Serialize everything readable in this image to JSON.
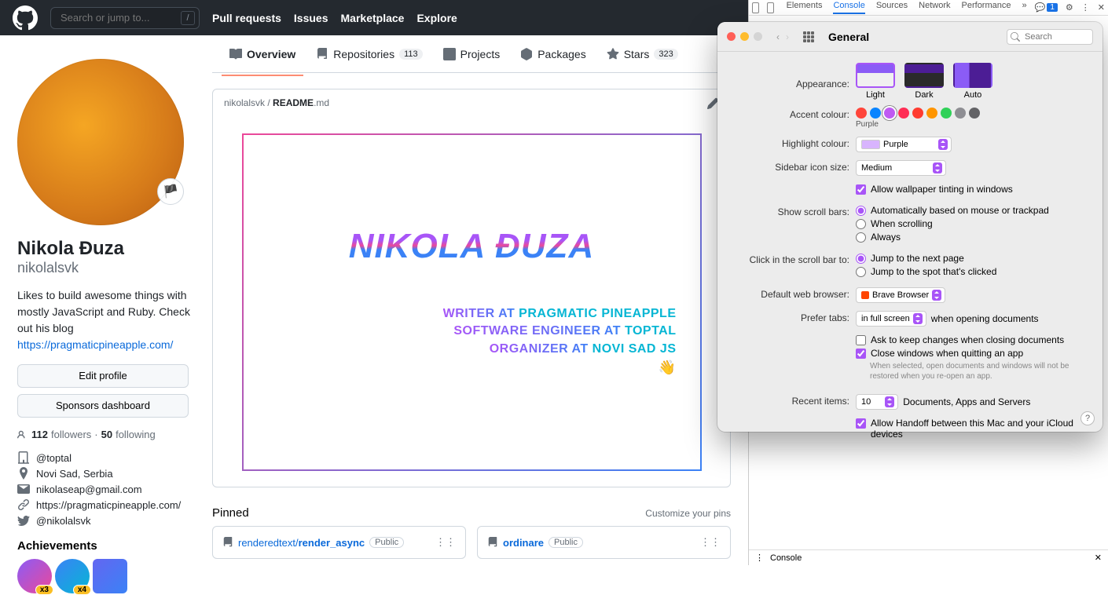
{
  "github": {
    "search_placeholder": "Search or jump to...",
    "slash": "/",
    "nav": {
      "pull": "Pull requests",
      "issues": "Issues",
      "marketplace": "Marketplace",
      "explore": "Explore"
    },
    "plus_caret": "+"
  },
  "profile": {
    "full_name": "Nikola Đuza",
    "username": "nikolalsvk",
    "bio_1": "Likes to build awesome things with mostly JavaScript and Ruby. Check out his blog ",
    "bio_link": "https://pragmaticpineapple.com/",
    "edit_btn": "Edit profile",
    "sponsors_btn": "Sponsors dashboard",
    "followers_n": "112",
    "followers_l": "followers",
    "following_n": "50",
    "following_l": "following",
    "org": "@toptal",
    "location": "Novi Sad, Serbia",
    "email": "nikolaseap@gmail.com",
    "website": "https://pragmaticpineapple.com/",
    "twitter": "@nikolalsvk",
    "achievements_h": "Achievements",
    "ach1_c": "x3",
    "ach2_c": "x4",
    "status_emoji": "🏴"
  },
  "tabs": {
    "overview": "Overview",
    "repos": "Repositories",
    "repos_n": "113",
    "projects": "Projects",
    "packages": "Packages",
    "stars": "Stars",
    "stars_n": "323"
  },
  "readme": {
    "path_user": "nikolalsvk",
    "path_sep": " / ",
    "path_file": "README",
    "path_ext": ".md",
    "banner_name": "NIKOLA ĐUZA",
    "line1a": "WRITER AT ",
    "line1b": "PRAGMATIC PINEAPPLE",
    "line2a": "SOFTWARE ENGINEER AT ",
    "line2b": "TOPTAL",
    "line3a": "ORGANIZER AT ",
    "line3b": "NOVI SAD JS",
    "wave": "👋"
  },
  "pinned": {
    "title": "Pinned",
    "customize": "Customize your pins",
    "r1_owner": "renderedtext/",
    "r1_name": "render_async",
    "r1_vis": "Public",
    "r2_name": "ordinare",
    "r2_vis": "Public"
  },
  "devtools": {
    "tabs": {
      "elements": "Elements",
      "console": "Console",
      "sources": "Sources",
      "network": "Network",
      "performance": "Performance"
    },
    "badge": "1",
    "console_label": "Console"
  },
  "mac": {
    "title": "General",
    "search_placeholder": "Search",
    "appearance_l": "Appearance:",
    "app_light": "Light",
    "app_dark": "Dark",
    "app_auto": "Auto",
    "accent_l": "Accent colour:",
    "accent_sel_label": "Purple",
    "accent_colors": [
      "#ff453a",
      "#0a84ff",
      "#bf5af2",
      "#ff2d55",
      "#ff3b30",
      "#ff9500",
      "#30d158",
      "#8e8e93",
      "#636366"
    ],
    "highlight_l": "Highlight colour:",
    "highlight_v": "Purple",
    "sidebar_l": "Sidebar icon size:",
    "sidebar_v": "Medium",
    "tinting": "Allow wallpaper tinting in windows",
    "scroll_l": "Show scroll bars:",
    "scroll_1": "Automatically based on mouse or trackpad",
    "scroll_2": "When scrolling",
    "scroll_3": "Always",
    "click_l": "Click in the scroll bar to:",
    "click_1": "Jump to the next page",
    "click_2": "Jump to the spot that's clicked",
    "browser_l": "Default web browser:",
    "browser_v": "Brave Browser",
    "tabs_l": "Prefer tabs:",
    "tabs_v": "in full screen",
    "tabs_suffix": "when opening documents",
    "ask_keep": "Ask to keep changes when closing documents",
    "close_win": "Close windows when quitting an app",
    "close_desc": "When selected, open documents and windows will not be restored when you re-open an app.",
    "recent_l": "Recent items:",
    "recent_v": "10",
    "recent_suffix": "Documents, Apps and Servers",
    "handoff": "Allow Handoff between this Mac and your iCloud devices",
    "help": "?"
  }
}
